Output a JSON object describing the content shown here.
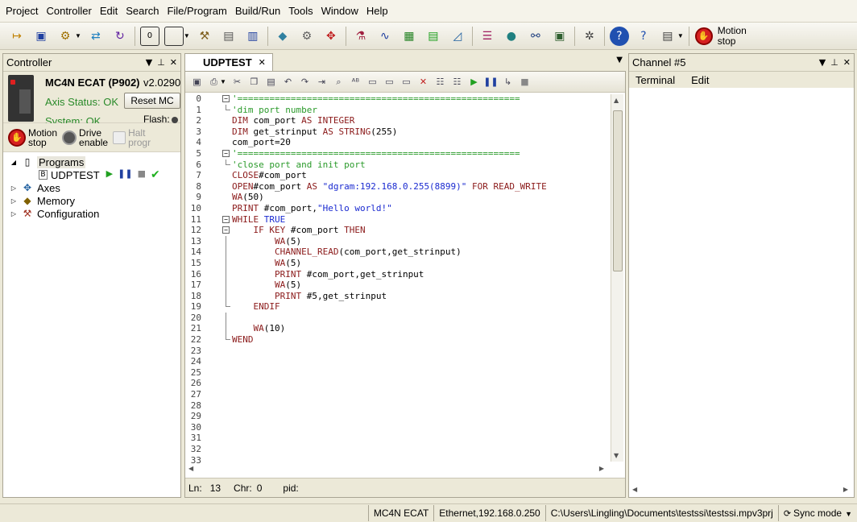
{
  "menu": [
    "Project",
    "Controller",
    "Edit",
    "Search",
    "File/Program",
    "Build/Run",
    "Tools",
    "Window",
    "Help"
  ],
  "toolbar": {
    "icons": [
      "import-icon",
      "save-icon",
      "program-manager-icon",
      "transfer-icon",
      "reset-icon",
      "terminal-zero-icon",
      "window-icon",
      "tools-icon",
      "parameters-icon",
      "chart-icon",
      "robot-icon",
      "gear-assembly-icon",
      "axis-move-icon",
      "monitor-icon",
      "scope-icon",
      "vr-icon",
      "table-icon",
      "table-green-icon",
      "graph-icon",
      "list-icon",
      "vr-badge-icon",
      "plc-icon",
      "screen-icon",
      "settings-gear-icon",
      "help-icon",
      "help-document-icon",
      "iec-icon"
    ],
    "stop_label_1": "Motion",
    "stop_label_2": "stop"
  },
  "controller_panel": {
    "title": "Controller",
    "name": "MC4N ECAT (P902)",
    "version": "v2.0290",
    "axis_status": "Axis Status: OK",
    "reset_label": "Reset MC",
    "system_status": "System: OK",
    "flash": "Flash:",
    "motion_stop_1": "Motion",
    "motion_stop_2": "stop",
    "drive_enable_1": "Drive",
    "drive_enable_2": "enable",
    "halt_1": "Halt",
    "halt_2": "progr",
    "tree": {
      "programs": "Programs",
      "udptest": "UDPTEST",
      "axes": "Axes",
      "memory": "Memory",
      "configuration": "Configuration"
    }
  },
  "editor": {
    "tab": "UDPTEST",
    "lines": [
      {
        "n": "0",
        "fold": "start",
        "t": [
          [
            "comment",
            "'====================================================="
          ]
        ]
      },
      {
        "n": "1",
        "fold": "end",
        "t": [
          [
            "comment",
            "'dim port number"
          ]
        ]
      },
      {
        "n": "2",
        "fold": "",
        "t": [
          [
            "kw",
            "DIM "
          ],
          [
            "pl",
            "com_port "
          ],
          [
            "kw",
            "AS INTEGER"
          ]
        ]
      },
      {
        "n": "3",
        "fold": "",
        "t": [
          [
            "kw",
            "DIM "
          ],
          [
            "pl",
            "get_strinput "
          ],
          [
            "kw",
            "AS STRING"
          ],
          [
            "pl",
            "(255)"
          ]
        ]
      },
      {
        "n": "4",
        "fold": "",
        "t": [
          [
            "pl",
            "com_port=20"
          ]
        ]
      },
      {
        "n": "5",
        "fold": "start",
        "t": [
          [
            "comment",
            "'====================================================="
          ]
        ]
      },
      {
        "n": "6",
        "fold": "end",
        "t": [
          [
            "comment",
            "'close port and init port"
          ]
        ]
      },
      {
        "n": "7",
        "fold": "",
        "t": [
          [
            "kw",
            "CLOSE"
          ],
          [
            "pl",
            "#com_port"
          ]
        ]
      },
      {
        "n": "8",
        "fold": "",
        "t": [
          [
            "kw",
            "OPEN"
          ],
          [
            "pl",
            "#com_port "
          ],
          [
            "kw",
            "AS "
          ],
          [
            "str",
            "\"dgram:192.168.0.255(8899)\""
          ],
          [
            "kw",
            " FOR READ_WRITE"
          ]
        ]
      },
      {
        "n": "9",
        "fold": "",
        "t": [
          [
            "kw",
            "WA"
          ],
          [
            "pl",
            "(50)"
          ]
        ]
      },
      {
        "n": "10",
        "fold": "",
        "t": [
          [
            "kw",
            "PRINT "
          ],
          [
            "pl",
            "#com_port,"
          ],
          [
            "str",
            "\"Hello world!\""
          ]
        ]
      },
      {
        "n": "11",
        "fold": "start",
        "t": [
          [
            "kw",
            "WHILE "
          ],
          [
            "tr",
            "TRUE"
          ]
        ]
      },
      {
        "n": "12",
        "fold": "start",
        "t": [
          [
            "pl",
            "    "
          ],
          [
            "kw",
            "IF KEY "
          ],
          [
            "pl",
            "#com_port "
          ],
          [
            "kw",
            "THEN"
          ]
        ]
      },
      {
        "n": "13",
        "fold": "line",
        "t": [
          [
            "pl",
            "        "
          ],
          [
            "kw",
            "WA"
          ],
          [
            "pl",
            "(5)"
          ]
        ]
      },
      {
        "n": "14",
        "fold": "line",
        "t": [
          [
            "pl",
            "        "
          ],
          [
            "kw",
            "CHANNEL_READ"
          ],
          [
            "pl",
            "(com_port,get_strinput)"
          ]
        ]
      },
      {
        "n": "15",
        "fold": "line",
        "t": [
          [
            "pl",
            "        "
          ],
          [
            "kw",
            "WA"
          ],
          [
            "pl",
            "(5)"
          ]
        ]
      },
      {
        "n": "16",
        "fold": "line",
        "t": [
          [
            "pl",
            "        "
          ],
          [
            "kw",
            "PRINT "
          ],
          [
            "pl",
            "#com_port,get_strinput"
          ]
        ]
      },
      {
        "n": "17",
        "fold": "line",
        "t": [
          [
            "pl",
            "        "
          ],
          [
            "kw",
            "WA"
          ],
          [
            "pl",
            "(5)"
          ]
        ]
      },
      {
        "n": "18",
        "fold": "line",
        "t": [
          [
            "pl",
            "        "
          ],
          [
            "kw",
            "PRINT "
          ],
          [
            "pl",
            "#5,get_strinput"
          ]
        ]
      },
      {
        "n": "19",
        "fold": "end",
        "t": [
          [
            "pl",
            "    "
          ],
          [
            "kw",
            "ENDIF"
          ]
        ]
      },
      {
        "n": "20",
        "fold": "line",
        "t": []
      },
      {
        "n": "21",
        "fold": "line",
        "t": [
          [
            "pl",
            "    "
          ],
          [
            "kw",
            "WA"
          ],
          [
            "pl",
            "(10)"
          ]
        ]
      },
      {
        "n": "22",
        "fold": "end",
        "t": [
          [
            "kw",
            "WEND"
          ]
        ]
      },
      {
        "n": "23",
        "fold": "",
        "t": []
      },
      {
        "n": "24",
        "fold": "",
        "t": []
      },
      {
        "n": "25",
        "fold": "",
        "t": []
      },
      {
        "n": "26",
        "fold": "",
        "t": []
      },
      {
        "n": "27",
        "fold": "",
        "t": []
      },
      {
        "n": "28",
        "fold": "",
        "t": []
      },
      {
        "n": "29",
        "fold": "",
        "t": []
      },
      {
        "n": "30",
        "fold": "",
        "t": []
      },
      {
        "n": "31",
        "fold": "",
        "t": []
      },
      {
        "n": "32",
        "fold": "",
        "t": []
      },
      {
        "n": "33",
        "fold": "",
        "t": []
      }
    ],
    "status": {
      "ln_label": "Ln:",
      "ln_value": "13",
      "chr_label": "Chr:",
      "chr_value": "0",
      "pid_label": "pid:"
    }
  },
  "channel_panel": {
    "title": "Channel #5",
    "menu_terminal": "Terminal",
    "menu_edit": "Edit"
  },
  "statusbar": {
    "controller": "MC4N ECAT",
    "connection": "Ethernet,192.168.0.250",
    "path": "C:\\Users\\Lingling\\Documents\\testssi\\testssi.mpv3prj",
    "sync": "Sync mode"
  },
  "colors": {
    "comment": "#2a9a2a",
    "keyword": "#8b1a1a",
    "string": "#1a2ad0",
    "ok": "#2a8a2a",
    "stop": "#d62020"
  }
}
